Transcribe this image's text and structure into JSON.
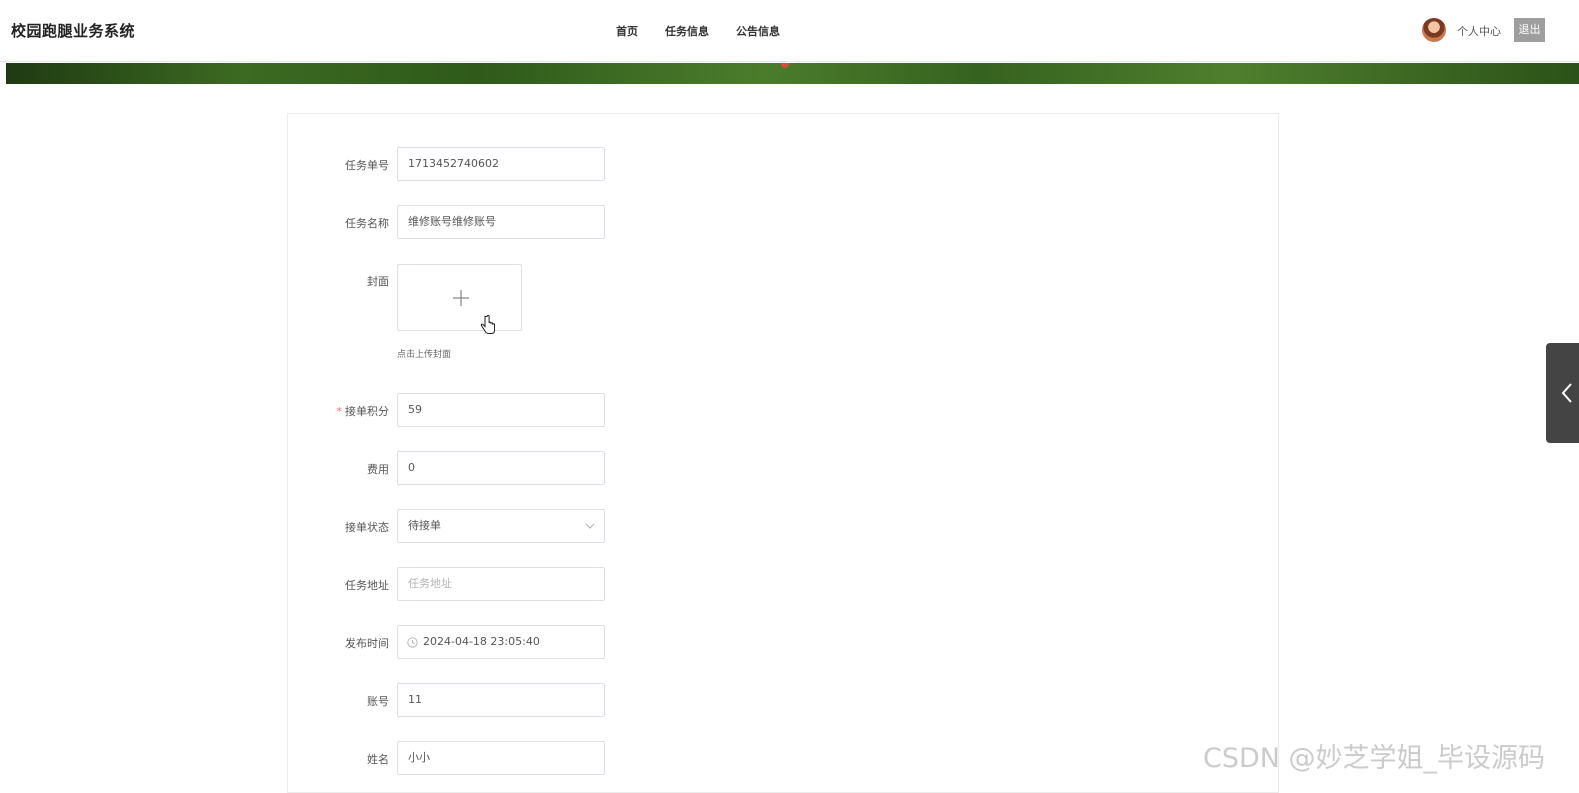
{
  "header": {
    "title": "校园跑腿业务系统",
    "nav": [
      "首页",
      "任务信息",
      "公告信息"
    ],
    "user_center": "个人中心",
    "logout": "退出"
  },
  "form": {
    "task_no": {
      "label": "任务单号",
      "value": "1713452740602"
    },
    "task_name": {
      "label": "任务名称",
      "value": "维修账号维修账号"
    },
    "cover": {
      "label": "封面",
      "hint": "点击上传封面",
      "icon": "plus-icon"
    },
    "points": {
      "label": "接单积分",
      "required": "*",
      "value": "59"
    },
    "fee": {
      "label": "费用",
      "value": "0"
    },
    "status": {
      "label": "接单状态",
      "value": "待接单"
    },
    "address": {
      "label": "任务地址",
      "placeholder": "任务地址"
    },
    "publish_time": {
      "label": "发布时间",
      "value": "2024-04-18 23:05:40"
    },
    "account": {
      "label": "账号",
      "value": "11"
    },
    "name": {
      "label": "姓名",
      "value": "小小"
    }
  },
  "watermark": "CSDN @妙芝学姐_毕设源码",
  "colors": {
    "required": "#f56c6c",
    "logout_bg": "#9e9e9e",
    "side_tab": "#444444"
  }
}
